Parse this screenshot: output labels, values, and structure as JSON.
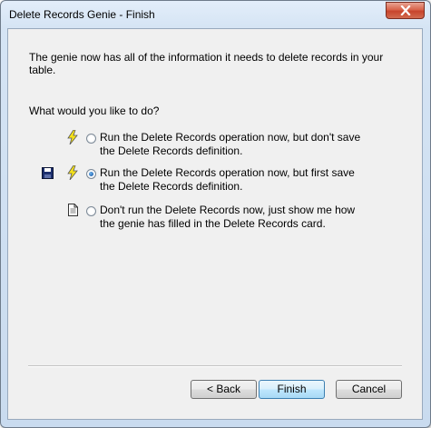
{
  "window": {
    "title": "Delete Records Genie - Finish"
  },
  "intro_text_line1": "The genie now has all of the information it needs to delete records in your",
  "intro_text_line2": "table.",
  "question": "What would you like to do?",
  "options": [
    {
      "line1": "Run the Delete Records operation now, but don't save",
      "line2": "the Delete Records definition.",
      "selected": false,
      "icons": [
        "lightning-icon"
      ]
    },
    {
      "line1": "Run the Delete Records operation now, but first save",
      "line2": "the Delete Records definition.",
      "selected": true,
      "icons": [
        "save-disk-icon",
        "lightning-icon"
      ]
    },
    {
      "line1": "Don't run the Delete Records now, just show me how",
      "line2": "the genie has filled in the Delete Records card.",
      "selected": false,
      "icons": [
        "document-icon"
      ]
    }
  ],
  "buttons": {
    "back": "< Back",
    "finish": "Finish",
    "cancel": "Cancel"
  }
}
